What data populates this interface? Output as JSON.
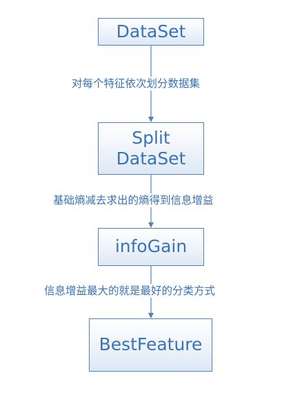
{
  "nodes": {
    "dataset": "DataSet",
    "split_line1": "Split",
    "split_line2": "DataSet",
    "infogain": "infoGain",
    "bestfeature": "BestFeature"
  },
  "edges": {
    "dataset_to_split": "对每个特征依次划分数据集",
    "split_to_infogain": "基础熵减去求出的熵得到信息增益",
    "infogain_to_bestfeature": "信息增益最大的就是最好的分类方式"
  },
  "colors": {
    "accent": "#4f81bd",
    "text": "#3a73b5",
    "background": "#ffffff"
  }
}
